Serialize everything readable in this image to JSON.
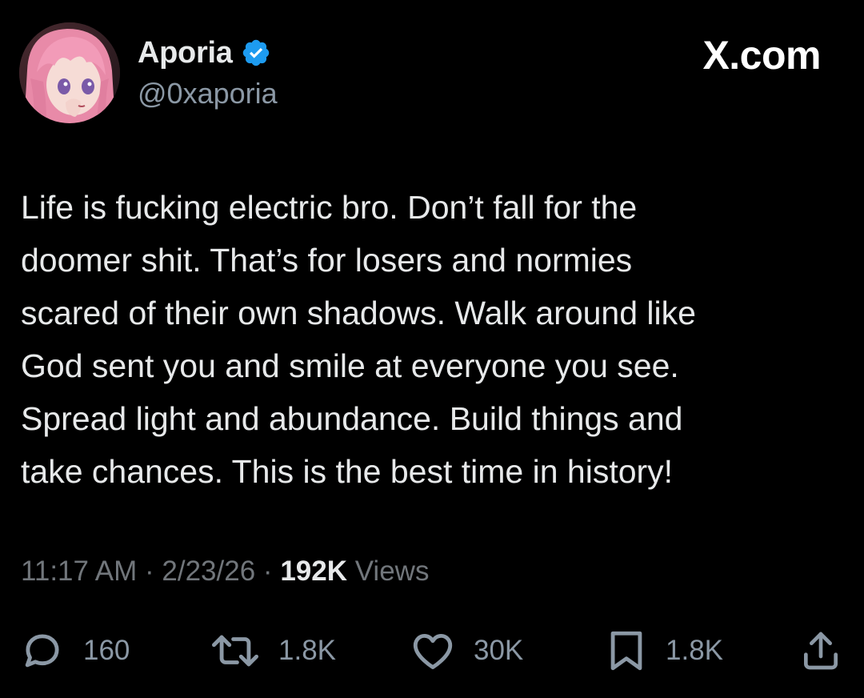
{
  "author": {
    "display_name": "Aporia",
    "handle": "@0xaporia",
    "avatar_icon": "anime-avatar-pink-hair",
    "verified_icon": "verified-badge-icon",
    "verified_color": "#1d9bf0"
  },
  "brand": {
    "label": "X.com"
  },
  "tweet": {
    "text": "Life is fucking electric bro. Don’t fall for the\ndoomer shit. That’s for losers and normies\nscared of their own shadows. Walk around like\nGod sent you and smile at everyone you see.\nSpread light and abundance. Build things and\ntake chances. This is the best time in history!",
    "time": "11:17 AM",
    "separator": "·",
    "date": "2/23/26",
    "views_count": "192K",
    "views_label": "Views"
  },
  "actions": {
    "reply": {
      "icon": "reply-icon",
      "count": "160"
    },
    "retweet": {
      "icon": "retweet-icon",
      "count": "1.8K"
    },
    "like": {
      "icon": "heart-icon",
      "count": "30K"
    },
    "bookmark": {
      "icon": "bookmark-icon",
      "count": "1.8K"
    },
    "share": {
      "icon": "share-icon"
    }
  },
  "colors": {
    "background": "#000000",
    "text_primary": "#e7e9ea",
    "text_secondary": "#71767b",
    "icon_gray": "#8b98a5"
  }
}
